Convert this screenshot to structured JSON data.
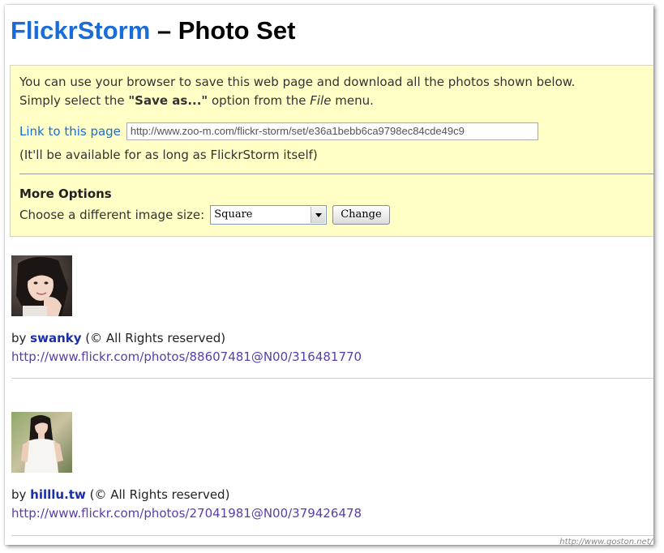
{
  "header": {
    "brand": "FlickrStorm",
    "title_rest": " – Photo Set"
  },
  "info": {
    "line1": "You can use your browser to save this web page and download all the photos shown below.",
    "line2_pre": "Simply select the ",
    "line2_bold": "\"Save as...\"",
    "line2_mid": " option from the ",
    "line2_italic": "File",
    "line2_post": " menu.",
    "link_label": "Link to this page",
    "link_value": "http://www.zoo-m.com/flickr-storm/set/e36a1bebb6ca9798ec84cde49c9",
    "availability": "(It'll be available for as long as FlickrStorm itself)",
    "more_options": "More Options",
    "size_label": "Choose a different image size:",
    "size_selected": "Square",
    "change_button": "Change"
  },
  "photos": [
    {
      "by": "by ",
      "user": "swanky",
      "rights": " (© All Rights reserved)",
      "url": "http://www.flickr.com/photos/88607481@N00/316481770"
    },
    {
      "by": "by ",
      "user": "hilllu.tw",
      "rights": " (© All Rights reserved)",
      "url": "http://www.flickr.com/photos/27041981@N00/379426478"
    }
  ],
  "watermark": "http://www.goston.net/",
  "colors": {
    "brand": "#1a6cd9",
    "info_bg": "#ffffc6",
    "user_link": "#1a2fa8",
    "url_link": "#5a3dab"
  }
}
